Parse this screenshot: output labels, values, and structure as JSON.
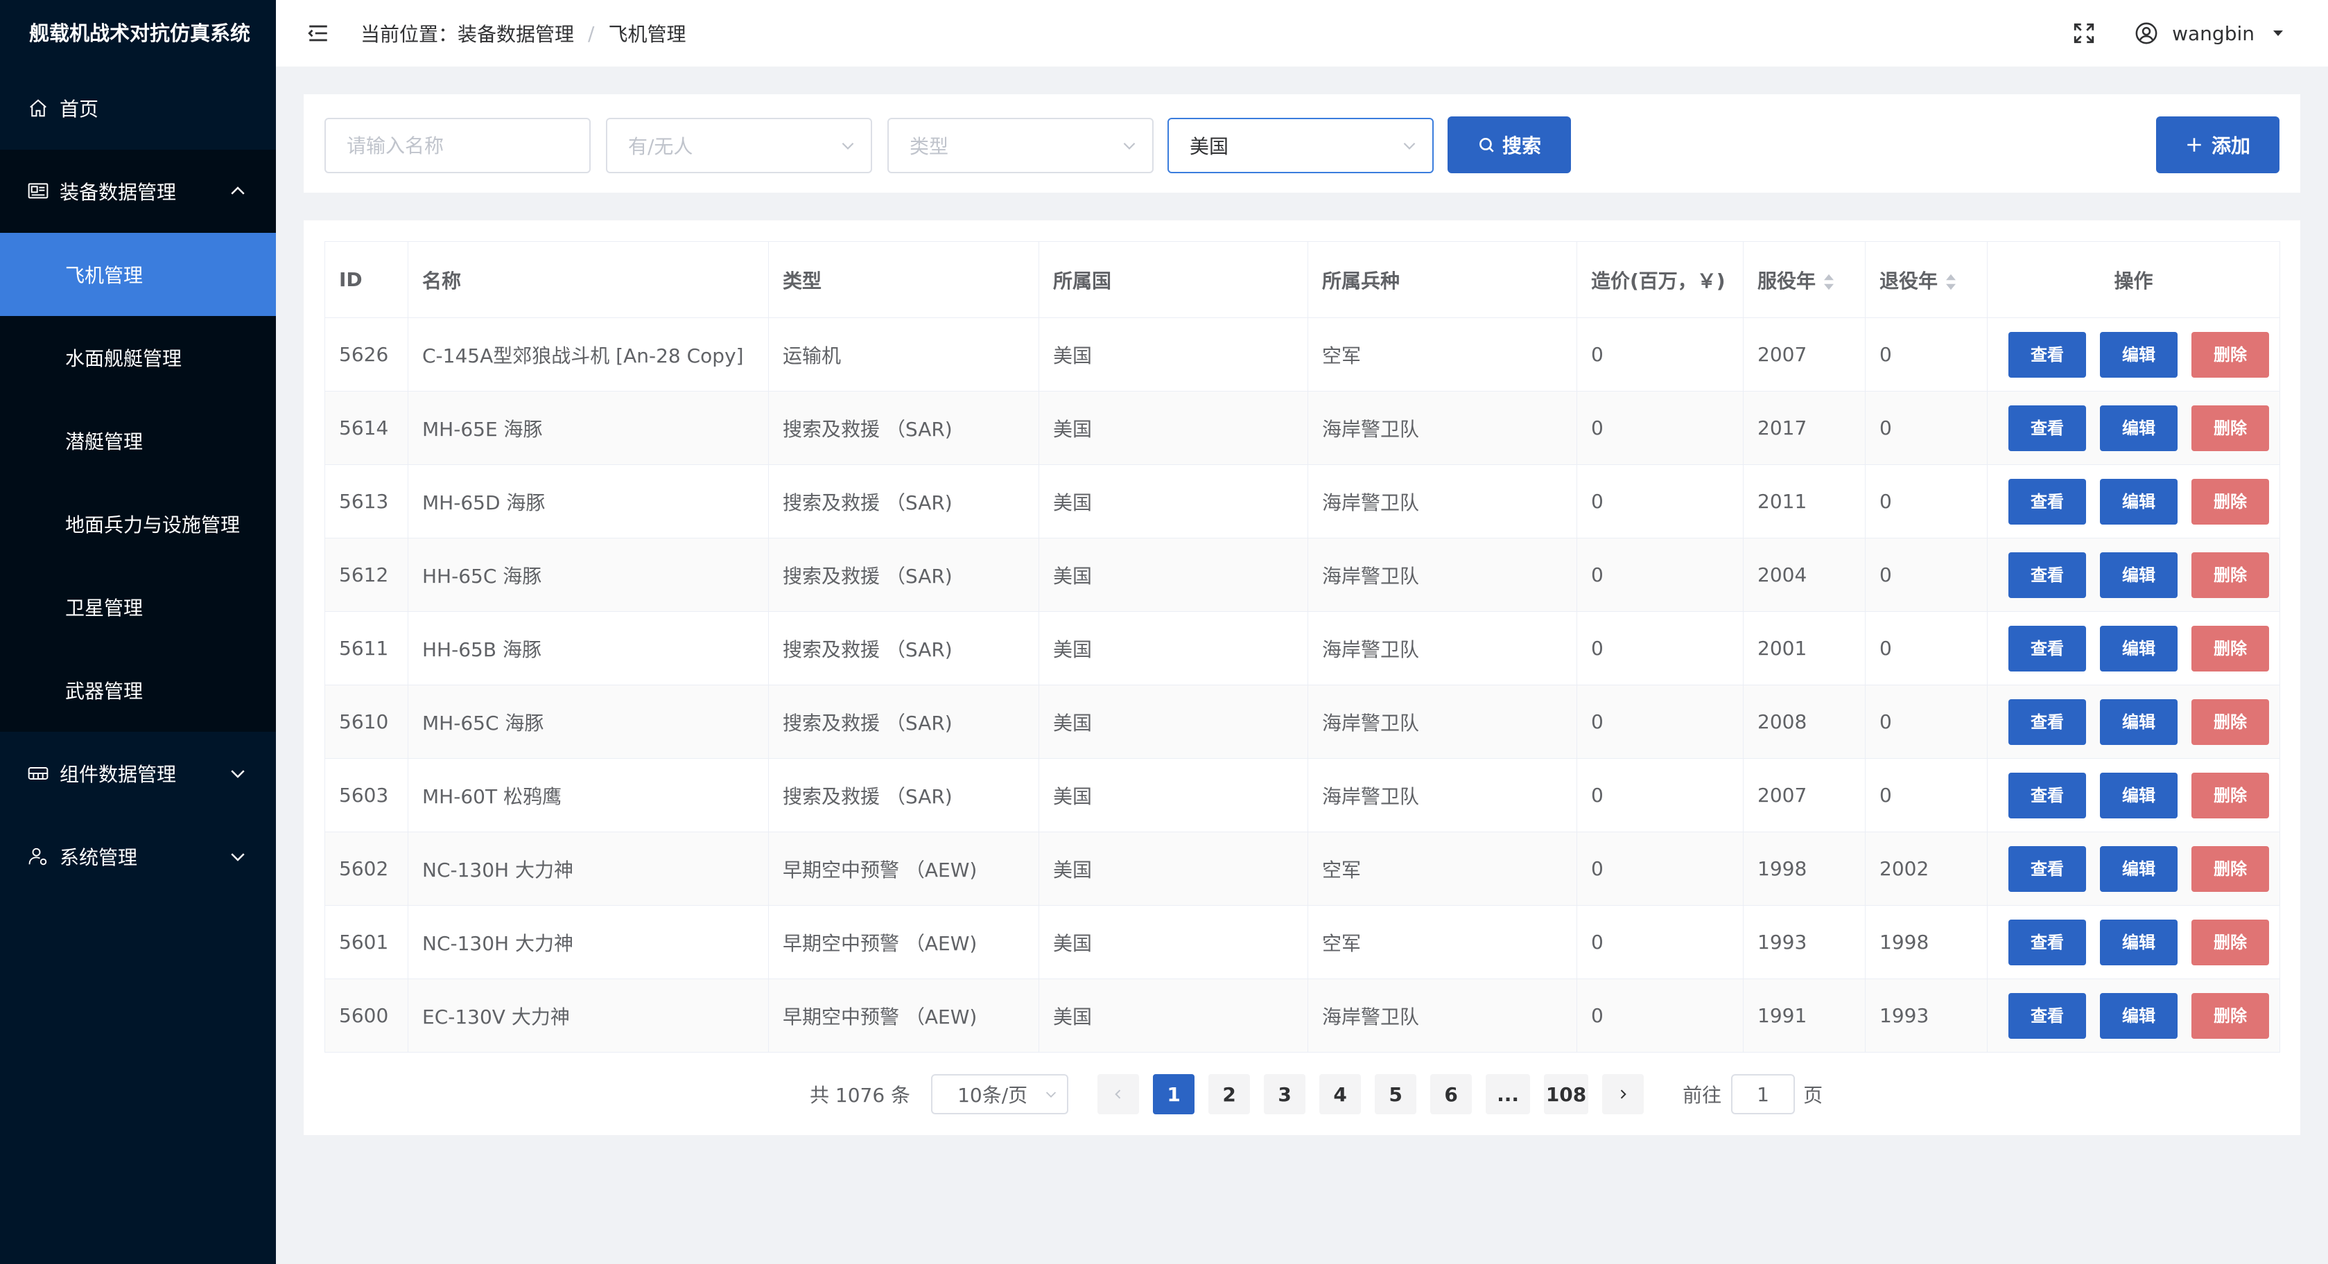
{
  "app": {
    "title": "舰载机战术对抗仿真系统"
  },
  "sidebar": {
    "home": "首页",
    "equipment": {
      "label": "装备数据管理",
      "items": [
        "飞机管理",
        "水面舰艇管理",
        "潜艇管理",
        "地面兵力与设施管理",
        "卫星管理",
        "武器管理"
      ],
      "active_index": 0
    },
    "components": "组件数据管理",
    "system": "系统管理"
  },
  "header": {
    "breadcrumb_prefix": "当前位置：",
    "breadcrumb_parent": "装备数据管理",
    "breadcrumb_sep": "/",
    "breadcrumb_current": "飞机管理",
    "username": "wangbin"
  },
  "filters": {
    "name_placeholder": "请输入名称",
    "manned_placeholder": "有/无人",
    "type_placeholder": "类型",
    "country_value": "美国",
    "search_label": "搜索",
    "add_label": "添加"
  },
  "table": {
    "columns": [
      "ID",
      "名称",
      "类型",
      "所属国",
      "所属兵种",
      "造价(百万，￥)",
      "服役年",
      "退役年",
      "操作"
    ],
    "actions": {
      "view": "查看",
      "edit": "编辑",
      "delete": "删除"
    },
    "rows": [
      [
        "5626",
        "C-145A型郊狼战斗机 [An-28 Copy]",
        "运输机",
        "美国",
        "空军",
        "0",
        "2007",
        "0"
      ],
      [
        "5614",
        "MH-65E 海豚",
        "搜索及救援 （SAR)",
        "美国",
        "海岸警卫队",
        "0",
        "2017",
        "0"
      ],
      [
        "5613",
        "MH-65D 海豚",
        "搜索及救援 （SAR)",
        "美国",
        "海岸警卫队",
        "0",
        "2011",
        "0"
      ],
      [
        "5612",
        "HH-65C 海豚",
        "搜索及救援 （SAR)",
        "美国",
        "海岸警卫队",
        "0",
        "2004",
        "0"
      ],
      [
        "5611",
        "HH-65B 海豚",
        "搜索及救援 （SAR)",
        "美国",
        "海岸警卫队",
        "0",
        "2001",
        "0"
      ],
      [
        "5610",
        "MH-65C 海豚",
        "搜索及救援 （SAR)",
        "美国",
        "海岸警卫队",
        "0",
        "2008",
        "0"
      ],
      [
        "5603",
        "MH-60T 松鸦鹰",
        "搜索及救援 （SAR)",
        "美国",
        "海岸警卫队",
        "0",
        "2007",
        "0"
      ],
      [
        "5602",
        "NC-130H 大力神",
        "早期空中预警 （AEW)",
        "美国",
        "空军",
        "0",
        "1998",
        "2002"
      ],
      [
        "5601",
        "NC-130H 大力神",
        "早期空中预警 （AEW)",
        "美国",
        "空军",
        "0",
        "1993",
        "1998"
      ],
      [
        "5600",
        "EC-130V 大力神",
        "早期空中预警 （AEW)",
        "美国",
        "海岸警卫队",
        "0",
        "1991",
        "1993"
      ]
    ]
  },
  "pagination": {
    "total_text": "共 1076 条",
    "page_size": "10条/页",
    "pages": [
      "1",
      "2",
      "3",
      "4",
      "5",
      "6",
      "...",
      "108"
    ],
    "current": "1",
    "goto_label": "前往",
    "goto_value": "1",
    "page_unit": "页"
  }
}
